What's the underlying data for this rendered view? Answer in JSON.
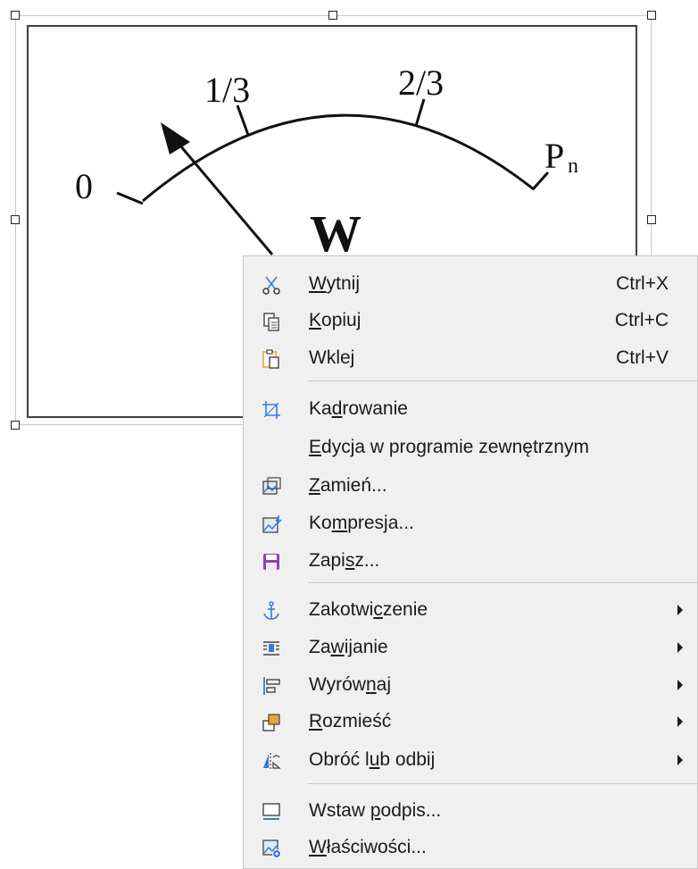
{
  "image": {
    "gauge_labels": {
      "zero": "0",
      "one_third": "1/3",
      "two_thirds": "2/3",
      "p_main": "P",
      "p_sub": "n",
      "w": "W"
    }
  },
  "context_menu": {
    "items": [
      {
        "id": "cut",
        "pre": "",
        "ul": "W",
        "post": "ytnij",
        "shortcut": "Ctrl+X",
        "icon": "scissors-icon"
      },
      {
        "id": "copy",
        "pre": "",
        "ul": "K",
        "post": "opiuj",
        "shortcut": "Ctrl+C",
        "icon": "copy-icon"
      },
      {
        "id": "paste",
        "pre": "Wkle",
        "ul": "j",
        "post": "",
        "shortcut": "Ctrl+V",
        "icon": "paste-icon"
      },
      {
        "id": "crop",
        "pre": "Ka",
        "ul": "d",
        "post": "rowanie",
        "shortcut": "",
        "icon": "crop-icon"
      },
      {
        "id": "external-edit",
        "pre": "",
        "ul": "E",
        "post": "dycja w programie zewnętrznym",
        "shortcut": "",
        "icon": ""
      },
      {
        "id": "replace",
        "pre": "",
        "ul": "Z",
        "post": "amień...",
        "shortcut": "",
        "icon": "replace-image-icon"
      },
      {
        "id": "compress",
        "pre": "Ko",
        "ul": "m",
        "post": "presja...",
        "shortcut": "",
        "icon": "compress-image-icon"
      },
      {
        "id": "save",
        "pre": "Zapi",
        "ul": "s",
        "post": "z...",
        "shortcut": "",
        "icon": "save-icon"
      },
      {
        "id": "anchor",
        "pre": "Zakotwi",
        "ul": "c",
        "post": "zenie",
        "submenu": true,
        "icon": "anchor-icon"
      },
      {
        "id": "wrap",
        "pre": "Za",
        "ul": "w",
        "post": "ijanie",
        "submenu": true,
        "icon": "wrap-icon"
      },
      {
        "id": "align",
        "pre": "Wyrów",
        "ul": "n",
        "post": "aj",
        "submenu": true,
        "icon": "align-icon"
      },
      {
        "id": "arrange",
        "pre": "",
        "ul": "R",
        "post": "ozmieść",
        "submenu": true,
        "icon": "arrange-icon"
      },
      {
        "id": "rotate",
        "pre": "Obróć l",
        "ul": "u",
        "post": "b odbij",
        "submenu": true,
        "icon": "rotate-flip-icon"
      },
      {
        "id": "caption",
        "pre": "Wstaw ",
        "ul": "p",
        "post": "odpis...",
        "shortcut": "",
        "icon": "caption-icon"
      },
      {
        "id": "properties",
        "pre": "",
        "ul": "W",
        "post": "łaściwości...",
        "shortcut": "",
        "icon": "properties-icon"
      }
    ]
  },
  "colors": {
    "menu_bg": "#f0f0f0",
    "icon_blue": "#3a7bd5",
    "icon_orange": "#e8a33d",
    "icon_purple": "#8e44ad"
  }
}
